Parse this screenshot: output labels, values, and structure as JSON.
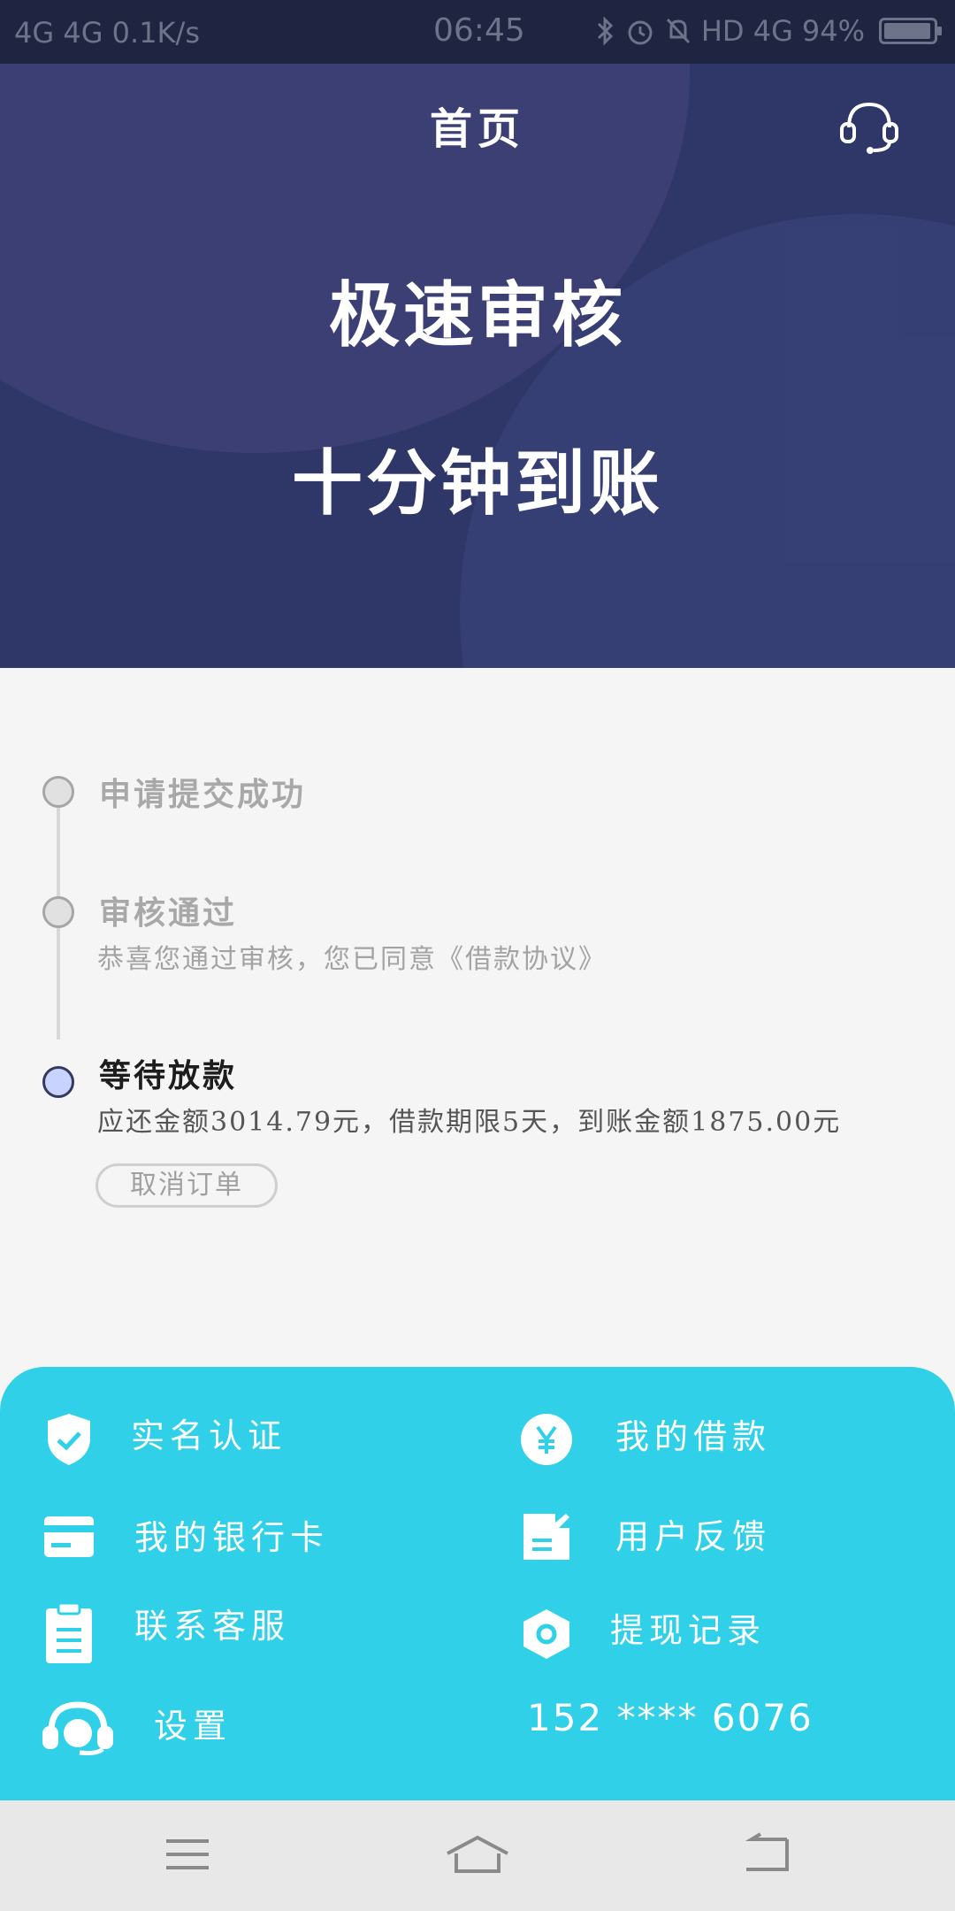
{
  "status_bar": {
    "signal_text": "4G 4G 0.1K/s",
    "time": "06:45",
    "right_text": "HD 4G",
    "battery": "94%",
    "battery_level": 0.94
  },
  "header": {
    "title": "首页"
  },
  "hero": {
    "line1": "极速审核",
    "line2": "十分钟到账"
  },
  "timeline": {
    "steps": [
      {
        "title": "申请提交成功",
        "desc": ""
      },
      {
        "title": "审核通过",
        "desc": "恭喜您通过审核，您已同意《借款协议》"
      },
      {
        "title": "等待放款",
        "desc": "应还金额3014.79元，借款期限5天，到账金额1875.00元"
      }
    ],
    "cancel_label": "取消订单"
  },
  "menu": {
    "items": [
      {
        "label": "实名认证",
        "icon": "shield-check-icon"
      },
      {
        "label": "我的借款",
        "icon": "yen-icon"
      },
      {
        "label": "我的银行卡",
        "icon": "bank-card-icon"
      },
      {
        "label": "用户反馈",
        "icon": "feedback-icon"
      },
      {
        "label": "联系客服",
        "icon": "clipboard-icon"
      },
      {
        "label": "提现记录",
        "icon": "hexagon-icon"
      },
      {
        "label": "设置",
        "icon": "headset-icon"
      }
    ],
    "phone": "152 **** 6076"
  },
  "colors": {
    "hero": "#2f3768",
    "menu": "#30d1e8",
    "background": "#f5f5f5"
  }
}
